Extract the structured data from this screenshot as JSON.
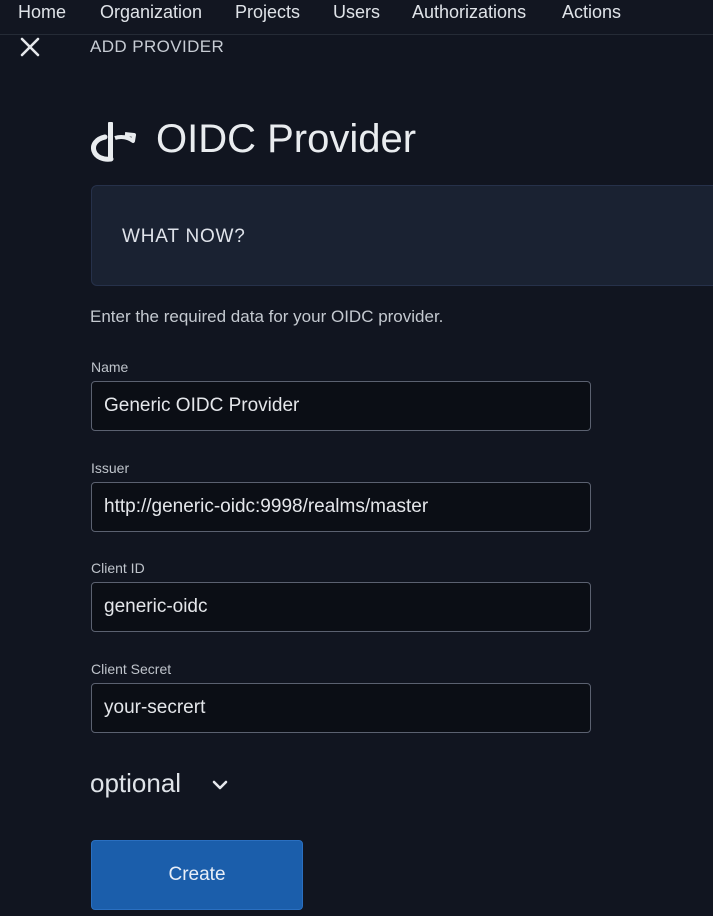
{
  "nav": {
    "items": [
      {
        "label": "Home"
      },
      {
        "label": "Organization"
      },
      {
        "label": "Projects"
      },
      {
        "label": "Users"
      },
      {
        "label": "Authorizations"
      },
      {
        "label": "Actions"
      }
    ]
  },
  "header": {
    "close_icon": "close-icon",
    "title": "ADD PROVIDER"
  },
  "provider": {
    "icon": "oidc-logo-icon",
    "title": "OIDC Provider"
  },
  "info": {
    "title": "WHAT NOW?"
  },
  "description": "Enter the required data for your OIDC provider.",
  "form": {
    "name": {
      "label": "Name",
      "value": "Generic OIDC Provider"
    },
    "issuer": {
      "label": "Issuer",
      "value": "http://generic-oidc:9998/realms/master"
    },
    "client_id": {
      "label": "Client ID",
      "value": "generic-oidc"
    },
    "client_secret": {
      "label": "Client Secret",
      "value": "your-secrert"
    }
  },
  "optional": {
    "label": "optional",
    "icon": "chevron-down-icon"
  },
  "actions": {
    "create_label": "Create"
  },
  "colors": {
    "background": "#111520",
    "primary_button": "#1b5eab",
    "info_box": "#1a2232"
  }
}
